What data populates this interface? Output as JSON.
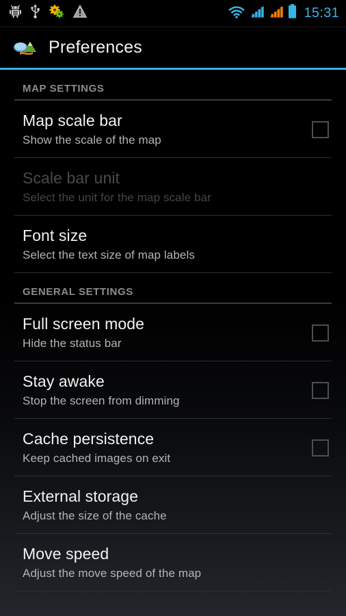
{
  "status_bar": {
    "icons_left": [
      "android-debug-icon",
      "usb-icon",
      "sync-gears-icon",
      "warning-triangle-icon"
    ],
    "icons_right": [
      "wifi-icon",
      "signal-sim1-icon",
      "signal-sim2-icon",
      "battery-icon"
    ],
    "time": "15:31",
    "accent_color": "#33b5e5",
    "signal2_color": "#ff7f00"
  },
  "action_bar": {
    "icon": "map-app-icon",
    "title": "Preferences",
    "accent_color": "#33b5e5"
  },
  "sections": [
    {
      "header": "MAP SETTINGS",
      "rows": [
        {
          "title": "Map scale bar",
          "summary": "Show the scale of the map",
          "has_checkbox": true,
          "checked": false,
          "disabled": false
        },
        {
          "title": "Scale bar unit",
          "summary": "Select the unit for the map scale bar",
          "has_checkbox": false,
          "checked": false,
          "disabled": true
        },
        {
          "title": "Font size",
          "summary": "Select the text size of map labels",
          "has_checkbox": false,
          "checked": false,
          "disabled": false
        }
      ]
    },
    {
      "header": "GENERAL SETTINGS",
      "rows": [
        {
          "title": "Full screen mode",
          "summary": "Hide the status bar",
          "has_checkbox": true,
          "checked": false,
          "disabled": false
        },
        {
          "title": "Stay awake",
          "summary": "Stop the screen from dimming",
          "has_checkbox": true,
          "checked": false,
          "disabled": false
        },
        {
          "title": "Cache persistence",
          "summary": "Keep cached images on exit",
          "has_checkbox": true,
          "checked": false,
          "disabled": false
        },
        {
          "title": "External storage",
          "summary": "Adjust the size of the cache",
          "has_checkbox": false,
          "checked": false,
          "disabled": false
        },
        {
          "title": "Move speed",
          "summary": "Adjust the move speed of the map",
          "has_checkbox": false,
          "checked": false,
          "disabled": false
        }
      ]
    }
  ]
}
